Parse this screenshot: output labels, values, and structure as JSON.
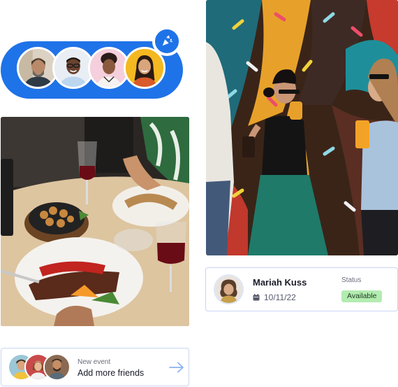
{
  "colors": {
    "accent": "#1f73e8",
    "card_border": "#c9d6f1",
    "status_available_bg": "#b3ecb1",
    "arrow": "#8db3f2"
  },
  "avatar_group": {
    "members": [
      "avatar-1",
      "avatar-2",
      "avatar-3",
      "avatar-4"
    ],
    "action_icon": "party-popper-icon"
  },
  "photos": {
    "dinner": "restaurant-dinner-photo",
    "street": "friends-drinks-mural-photo"
  },
  "profile_card": {
    "name": "Mariah Kuss",
    "date": "10/11/22",
    "date_icon": "calendar-icon",
    "status_label": "Status",
    "status_value": "Available"
  },
  "event_card": {
    "kicker": "New event",
    "title": "Add more friends",
    "arrow_icon": "arrow-right-icon"
  }
}
